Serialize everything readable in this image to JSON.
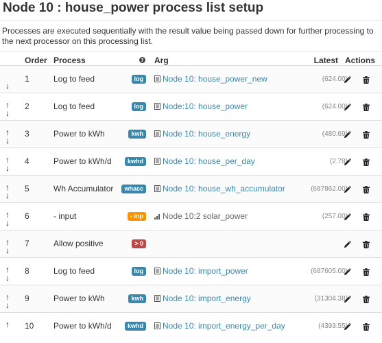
{
  "title": "Node 10 : house_power process list setup",
  "description": "Processes are executed sequentially with the result value being passed down for further processing to the next processor on this processing list.",
  "columns": {
    "order": "Order",
    "process": "Process",
    "arg": "Arg",
    "latest": "Latest",
    "actions": "Actions"
  },
  "rows": [
    {
      "order": "1",
      "process": "Log to feed",
      "badge": "log",
      "badge_color": "#3a87ad",
      "arg": "Node 10: house_power_new",
      "arg_icon": "feed-icon",
      "latest": "(624.00)",
      "up": false,
      "down": true
    },
    {
      "order": "2",
      "process": "Log to feed",
      "badge": "log",
      "badge_color": "#3a87ad",
      "arg": "Node:10: house_power",
      "arg_icon": "feed-icon",
      "latest": "(624.00)",
      "up": true,
      "down": true
    },
    {
      "order": "3",
      "process": "Power to kWh",
      "badge": "kwh",
      "badge_color": "#3a87ad",
      "arg": "Node 10: house_energy",
      "arg_icon": "feed-icon",
      "latest": "(480.69)",
      "up": true,
      "down": true
    },
    {
      "order": "4",
      "process": "Power to kWh/d",
      "badge": "kwhd",
      "badge_color": "#3a87ad",
      "arg": "Node 10: house_per_day",
      "arg_icon": "feed-icon",
      "latest": "(2.78)",
      "up": true,
      "down": true
    },
    {
      "order": "5",
      "process": "Wh Accumulator",
      "badge": "whacc",
      "badge_color": "#3a87ad",
      "arg": "Node 10: house_wh_accumulator",
      "arg_icon": "feed-icon",
      "latest": "(687862.00)",
      "up": true,
      "down": true
    },
    {
      "order": "6",
      "process": "- input",
      "badge": "- inp",
      "badge_color": "#f89406",
      "arg": "Node 10:2 solar_power",
      "arg_icon": "signal-icon",
      "latest": "(257.00)",
      "up": true,
      "down": true
    },
    {
      "order": "7",
      "process": "Allow positive",
      "badge": "> 0",
      "badge_color": "#b94a48",
      "arg": "",
      "arg_icon": "",
      "latest": "",
      "up": true,
      "down": true
    },
    {
      "order": "8",
      "process": "Log to feed",
      "badge": "log",
      "badge_color": "#3a87ad",
      "arg": "Node 10: import_power",
      "arg_icon": "feed-icon",
      "latest": "(687605.00)",
      "up": true,
      "down": true
    },
    {
      "order": "9",
      "process": "Power to kWh",
      "badge": "kwh",
      "badge_color": "#3a87ad",
      "arg": "Node 10: import_energy",
      "arg_icon": "feed-icon",
      "latest": "(31304.38)",
      "up": true,
      "down": true
    },
    {
      "order": "10",
      "process": "Power to kWh/d",
      "badge": "kwhd",
      "badge_color": "#3a87ad",
      "arg": "Node 10: import_energy_per_day",
      "arg_icon": "feed-icon",
      "latest": "(4393.55)",
      "up": true,
      "down": false
    }
  ]
}
